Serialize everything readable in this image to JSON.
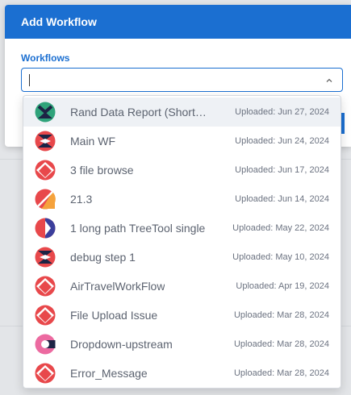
{
  "dialog": {
    "title": "Add Workflow",
    "field_label": "Workflows",
    "input_value": ""
  },
  "dropdown": {
    "options": [
      {
        "name": "Rand Data Report (Short…",
        "date": "Uploaded: Jun 27, 2024",
        "icon": "workflow-avatar-green-black"
      },
      {
        "name": "Main WF",
        "date": "Uploaded: Jun 24, 2024",
        "icon": "workflow-avatar-red-navy-x"
      },
      {
        "name": "3 file browse",
        "date": "Uploaded: Jun 17, 2024",
        "icon": "workflow-avatar-red-diamond"
      },
      {
        "name": "21.3",
        "date": "Uploaded: Jun 14, 2024",
        "icon": "workflow-avatar-red-orange"
      },
      {
        "name": "1 long path TreeTool single",
        "date": "Uploaded: May 22, 2024",
        "icon": "workflow-avatar-red-indigo"
      },
      {
        "name": "debug step 1",
        "date": "Uploaded: May 10, 2024",
        "icon": "workflow-avatar-red-navy-x"
      },
      {
        "name": "AirTravelWorkFlow",
        "date": "Uploaded: Apr 19, 2024",
        "icon": "workflow-avatar-red-diamond"
      },
      {
        "name": "File Upload Issue",
        "date": "Uploaded: Mar 28, 2024",
        "icon": "workflow-avatar-red-diamond"
      },
      {
        "name": "Dropdown-upstream",
        "date": "Uploaded: Mar 28, 2024",
        "icon": "workflow-avatar-pink-navy"
      },
      {
        "name": "Error_Message",
        "date": "Uploaded: Mar 28, 2024",
        "icon": "workflow-avatar-red-diamond"
      }
    ]
  },
  "colors": {
    "primary": "#1b6fd1",
    "red": "#e8484b",
    "navy": "#1d2445",
    "green": "#2fa37a",
    "orange": "#f5a23c",
    "indigo": "#3b3f9c",
    "pink": "#ec6aa0"
  }
}
